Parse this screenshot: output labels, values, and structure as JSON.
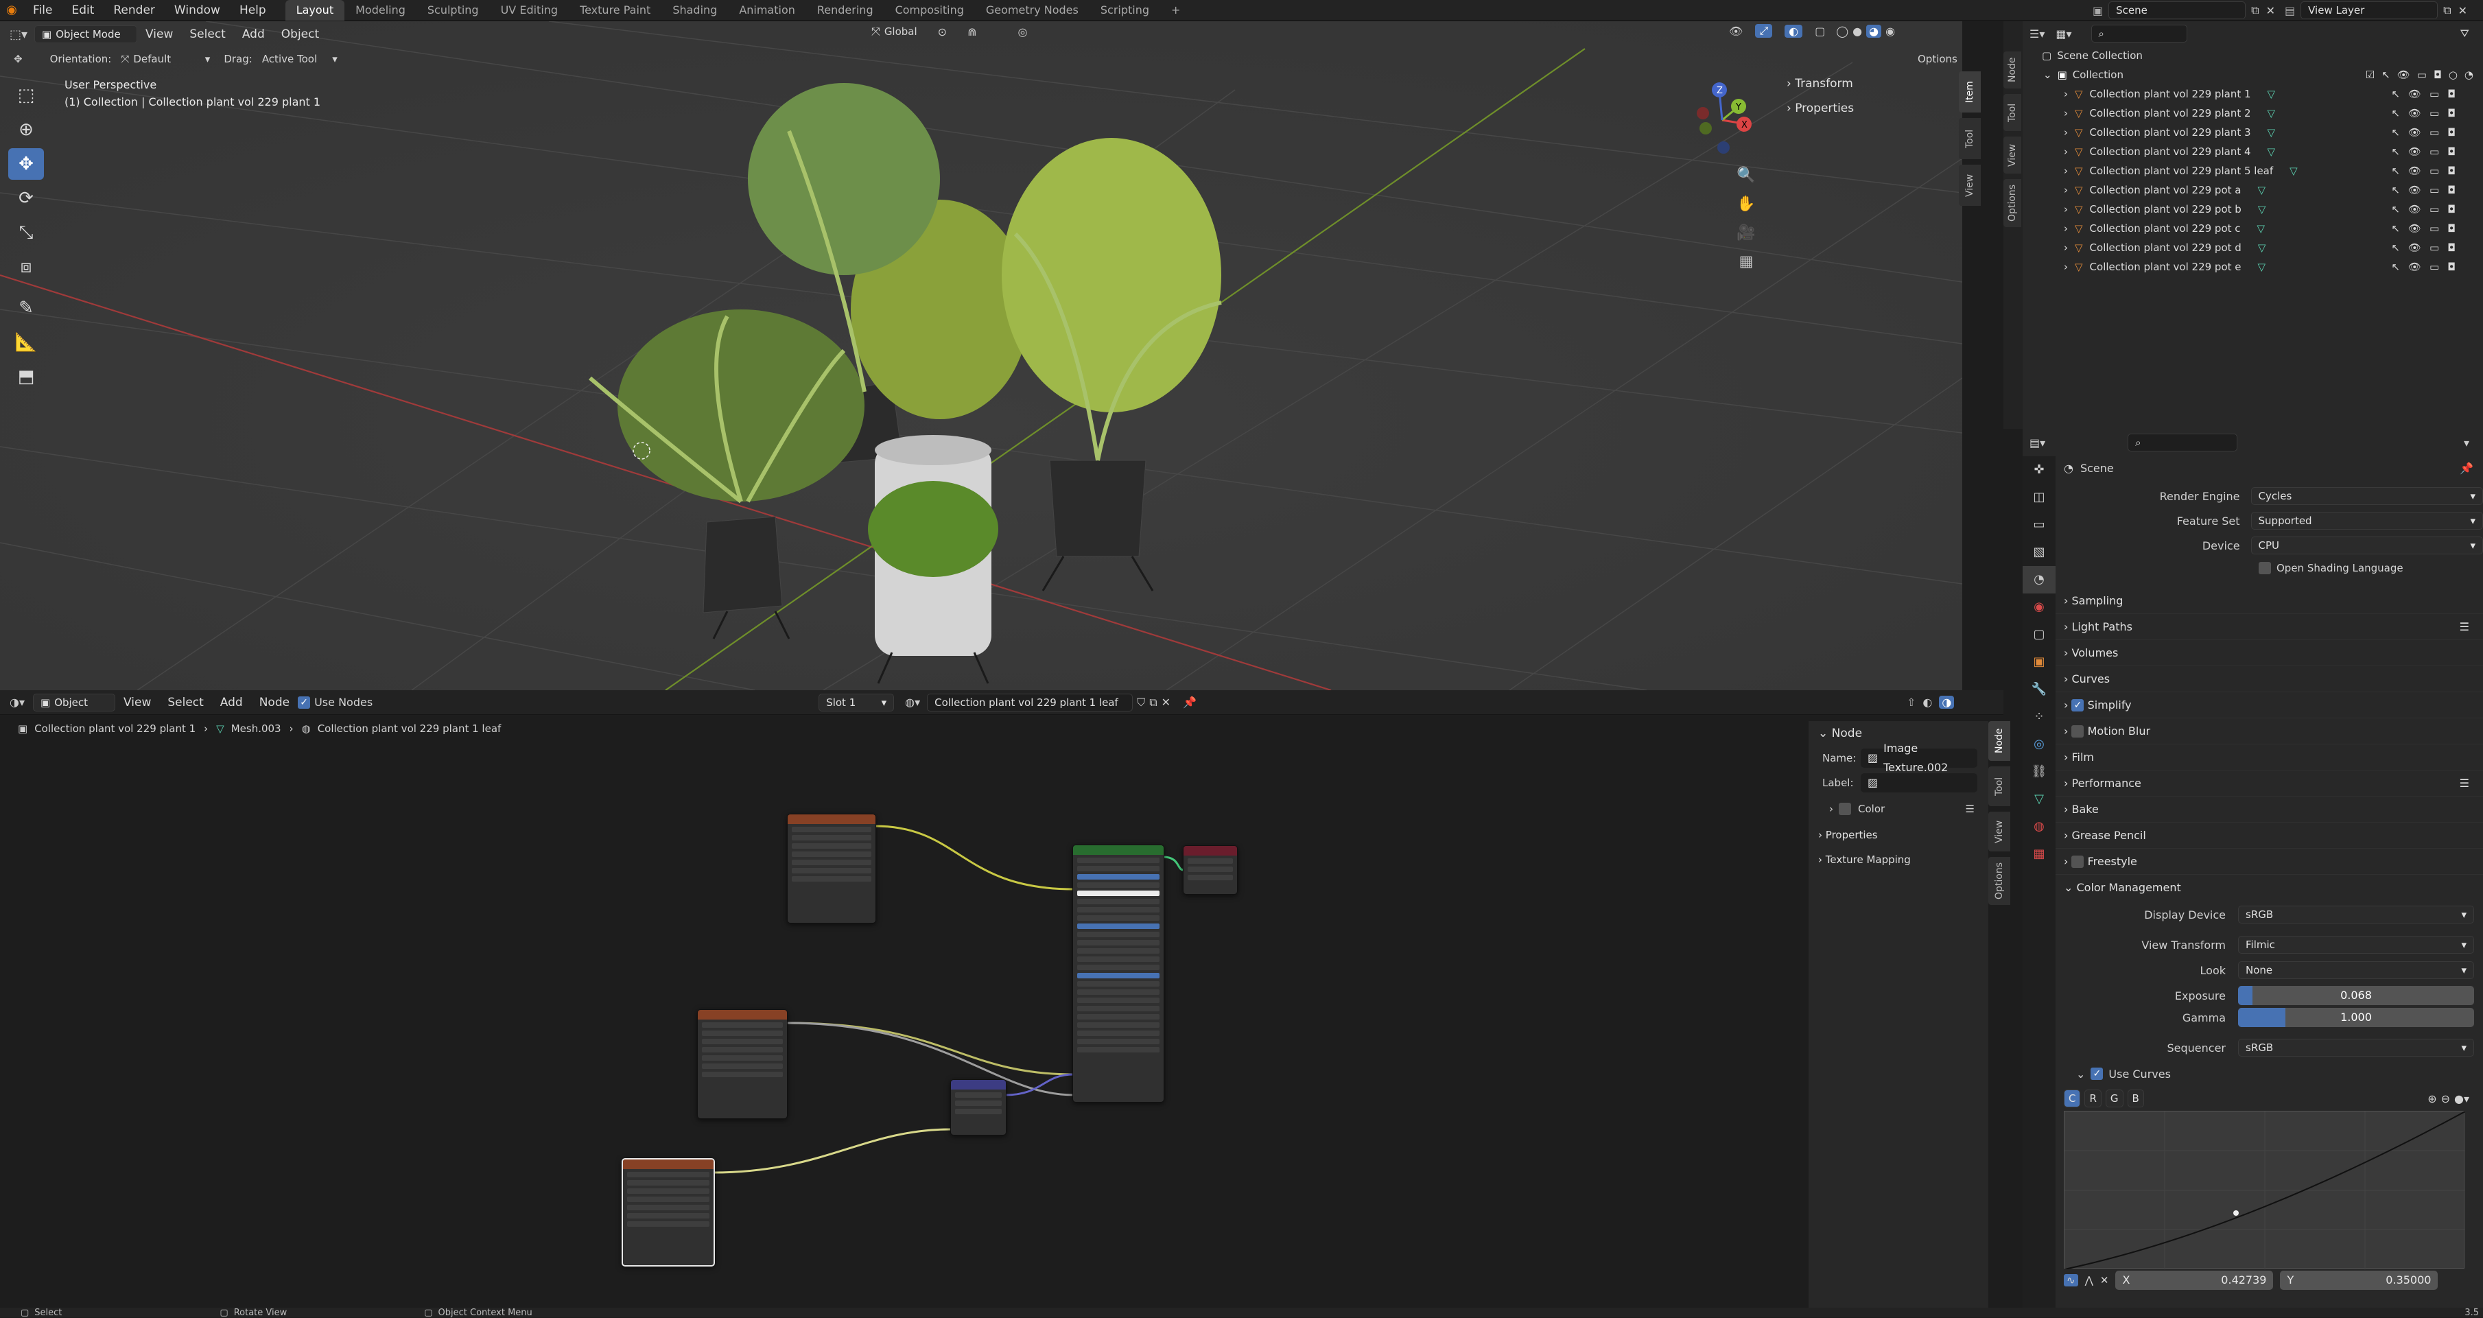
{
  "topbar": {
    "menus": [
      "File",
      "Edit",
      "Render",
      "Window",
      "Help"
    ],
    "workspaces": [
      "Layout",
      "Modeling",
      "Sculpting",
      "UV Editing",
      "Texture Paint",
      "Shading",
      "Animation",
      "Rendering",
      "Compositing",
      "Geometry Nodes",
      "Scripting"
    ],
    "active_workspace": "Layout",
    "add_tab": "+",
    "scene": "Scene",
    "view_layer": "View Layer"
  },
  "viewport": {
    "mode": "Object Mode",
    "menus": [
      "View",
      "Select",
      "Add",
      "Object"
    ],
    "transform_orientation": "Global",
    "orientation_label": "Orientation:",
    "orientation_value": "Default",
    "drag_label": "Drag:",
    "drag_value": "Active Tool",
    "options": "Options",
    "perspective_label": "User Perspective",
    "collection_label": "(1) Collection | Collection plant vol 229 plant 1",
    "n_panel": {
      "sections": [
        "Transform",
        "Properties"
      ],
      "tabs": [
        "Item",
        "Tool",
        "View"
      ]
    },
    "gizmo_axes": [
      "X",
      "Y",
      "Z"
    ]
  },
  "node_editor": {
    "type": "Object",
    "menus": [
      "View",
      "Select",
      "Add",
      "Node"
    ],
    "use_nodes": "Use Nodes",
    "slot": "Slot 1",
    "material": "Collection plant vol 229 plant 1 leaf",
    "breadcrumb": [
      "Collection plant vol 229 plant 1",
      "Mesh.003",
      "Collection plant vol 229 plant 1 leaf"
    ],
    "side_panel": {
      "header": "Node",
      "name_label": "Name:",
      "name_value": "Image Texture.002",
      "label_label": "Label:",
      "color": "Color",
      "properties": "Properties",
      "texture_mapping": "Texture Mapping",
      "tabs": [
        "Node",
        "Tool",
        "View",
        "Options"
      ]
    }
  },
  "outliner": {
    "root": "Scene Collection",
    "collection": "Collection",
    "items": [
      "Collection plant vol 229 plant 1",
      "Collection plant vol 229 plant 2",
      "Collection plant vol 229 plant 3",
      "Collection plant vol 229 plant 4",
      "Collection plant vol 229 plant 5 leaf",
      "Collection plant vol 229 pot a",
      "Collection plant vol 229 pot b",
      "Collection plant vol 229 pot c",
      "Collection plant vol 229 pot d",
      "Collection plant vol 229 pot e"
    ]
  },
  "properties": {
    "context": "Scene",
    "render_engine_label": "Render Engine",
    "render_engine": "Cycles",
    "feature_set_label": "Feature Set",
    "feature_set": "Supported",
    "device_label": "Device",
    "device": "CPU",
    "osl": "Open Shading Language",
    "sections": [
      "Sampling",
      "Light Paths",
      "Volumes",
      "Curves",
      "Simplify",
      "Motion Blur",
      "Film",
      "Performance",
      "Bake",
      "Grease Pencil",
      "Freestyle"
    ],
    "color_management": {
      "header": "Color Management",
      "display_device_label": "Display Device",
      "display_device": "sRGB",
      "view_transform_label": "View Transform",
      "view_transform": "Filmic",
      "look_label": "Look",
      "look": "None",
      "exposure_label": "Exposure",
      "exposure": "0.068",
      "exposure_fill": 0.06,
      "gamma_label": "Gamma",
      "gamma": "1.000",
      "gamma_fill": 0.2,
      "sequencer_label": "Sequencer",
      "sequencer": "sRGB",
      "use_curves": "Use Curves",
      "curve_channels": [
        "C",
        "R",
        "G",
        "B"
      ],
      "x_label": "X",
      "x_value": "0.42739",
      "y_label": "Y",
      "y_value": "0.35000"
    }
  },
  "status": {
    "select": "Select",
    "rotate": "Rotate View",
    "context_menu": "Object Context Menu",
    "version": "3.5"
  },
  "colors": {
    "accent": "#4772b3",
    "panel": "#282828",
    "viewport": "#393939"
  }
}
